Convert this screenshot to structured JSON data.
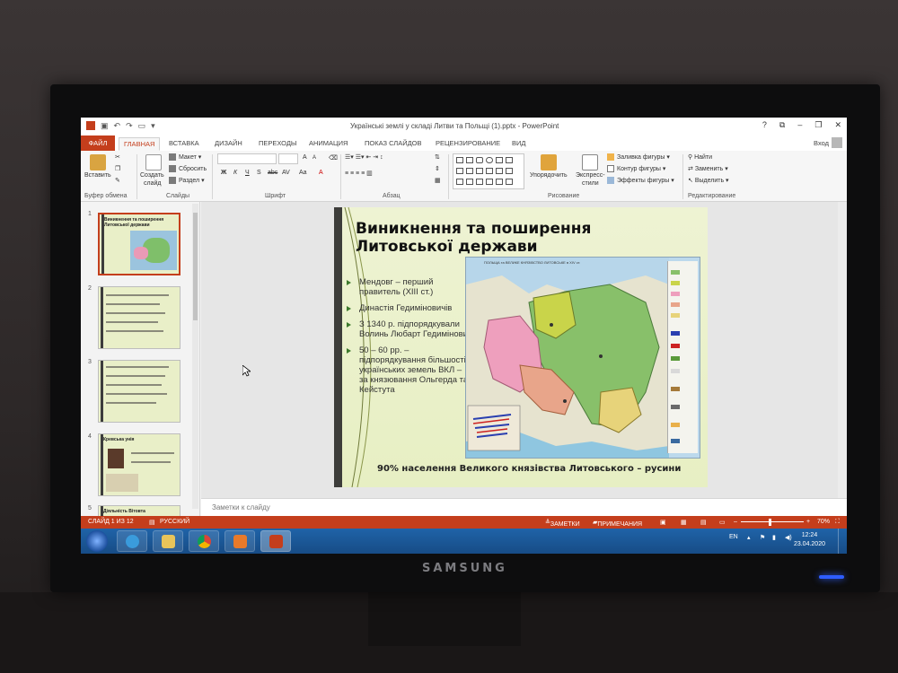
{
  "app": {
    "window_title": "Українські землі у складі Литви та Польщі (1).pptx - PowerPoint",
    "signin": "Вход",
    "window_controls": [
      "?",
      "⧉",
      "–",
      "❐",
      "✕"
    ]
  },
  "ribbon": {
    "file_tab": "ФАЙЛ",
    "tabs": [
      "ГЛАВНАЯ",
      "ВСТАВКА",
      "ДИЗАЙН",
      "ПЕРЕХОДЫ",
      "АНИМАЦИЯ",
      "ПОКАЗ СЛАЙДОВ",
      "РЕЦЕНЗИРОВАНИЕ",
      "ВИД"
    ],
    "active_tab": "ГЛАВНАЯ",
    "clipboard": {
      "paste": "Вставить",
      "label": "Буфер обмена"
    },
    "slides": {
      "new_slide_line1": "Создать",
      "new_slide_line2": "слайд",
      "layout": "Макет",
      "reset": "Сбросить",
      "section": "Раздел",
      "label": "Слайды"
    },
    "font": {
      "label": "Шрифт",
      "bold": "Ж",
      "italic": "К",
      "underline": "Ч",
      "strike": "S",
      "shadow": "abc",
      "grow": "A",
      "shrink": "A",
      "case": "Aa"
    },
    "paragraph": {
      "label": "Абзац"
    },
    "drawing": {
      "arrange": "Упорядочить",
      "quick_styles_line1": "Экспресс-",
      "quick_styles_line2": "стили",
      "fill": "Заливка фигуры",
      "outline": "Контур фигуры",
      "effects": "Эффекты фигуры",
      "label": "Рисование"
    },
    "editing": {
      "find": "Найти",
      "replace": "Заменить",
      "select": "Выделить",
      "label": "Редактирование"
    }
  },
  "thumbnails": [
    {
      "num": "1",
      "title": "Виникнення та поширення Литовської держави",
      "selected": true
    },
    {
      "num": "2",
      "title": "",
      "selected": false
    },
    {
      "num": "3",
      "title": "",
      "selected": false
    },
    {
      "num": "4",
      "title": "Кревська унія",
      "selected": false
    },
    {
      "num": "5",
      "title": "Діяльність Вітовта",
      "selected": false
    }
  ],
  "slide": {
    "title_line1": "Виникнення та поширення",
    "title_line2": "Литовської держави",
    "bullets": [
      "Мендовг – перший правитель  (XIII ст.)",
      "Династія Гедиміновичів",
      "З 1340 р. підпорядкували Волинь  Любарт Гедимінович",
      "50 – 60 рр. – підпорядкування більшості українських земель ВКЛ – за князювання Ольгерда та Кейстута"
    ],
    "footer": "90% населення Великого князівства Литовського – русини",
    "map_title": "ПОЛЬЩА та ВЕЛИКЕ КНЯЗІВСТВО ЛИТОВСЬКЕ в XIV ст."
  },
  "notes": {
    "placeholder": "Заметки к слайду"
  },
  "status": {
    "slide_counter": "СЛАЙД 1 ИЗ 12",
    "language": "РУССКИЙ",
    "notes_btn": "ЗАМЕТКИ",
    "comments_btn": "ПРИМЕЧАНИЯ",
    "zoom_minus": "–",
    "zoom_plus": "+",
    "zoom": "70%"
  },
  "taskbar": {
    "lang": "EN",
    "time": "12:24",
    "date": "23.04.2020"
  },
  "monitor": {
    "brand": "SAMSUNG"
  },
  "colors": {
    "accent": "#c43e1c",
    "slide_bg": "#e9efc8",
    "taskbar": "#1f63a8"
  }
}
